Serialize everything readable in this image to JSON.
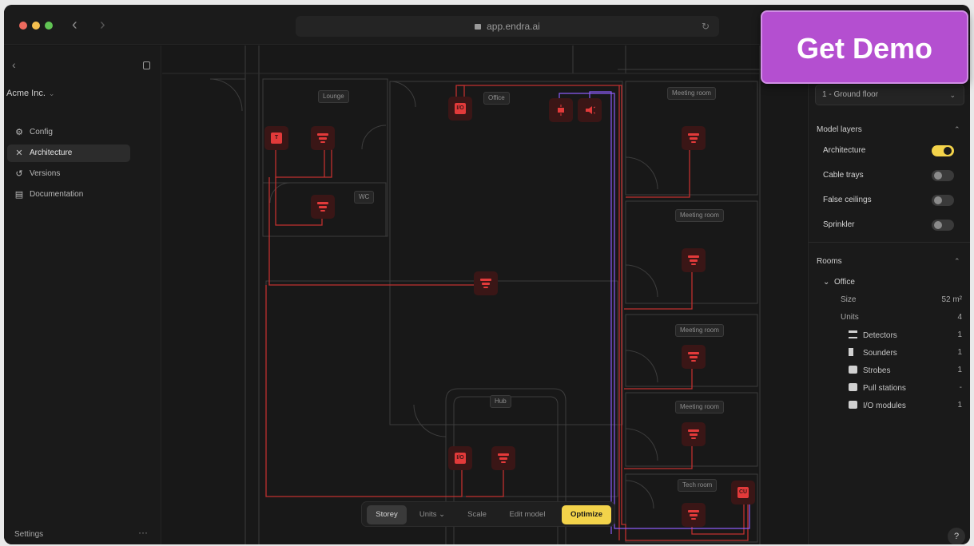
{
  "browser": {
    "url": "app.endra.ai"
  },
  "sidebar": {
    "org_name": "Acme Inc.",
    "items": [
      {
        "label": "Config",
        "icon": "config-icon"
      },
      {
        "label": "Architecture",
        "icon": "architecture-icon",
        "active": true
      },
      {
        "label": "Versions",
        "icon": "versions-icon"
      },
      {
        "label": "Documentation",
        "icon": "documentation-icon"
      }
    ],
    "settings_label": "Settings",
    "more_label": "···"
  },
  "canvas": {
    "rooms": [
      "Lounge",
      "Office",
      "Meeting room",
      "WC",
      "Meeting room",
      "Meeting room",
      "Hub",
      "Meeting room",
      "Tech room"
    ],
    "device_labels": {
      "io": "I/O",
      "pull": "T",
      "cu": "CU"
    }
  },
  "toolbar": {
    "storey": "Storey",
    "units": "Units",
    "scale": "Scale",
    "edit_model": "Edit model",
    "optimize": "Optimize"
  },
  "right_panel": {
    "floor": "1 - Ground floor",
    "model_layers_title": "Model layers",
    "layers": [
      {
        "label": "Architecture",
        "on": true
      },
      {
        "label": "Cable trays",
        "on": false
      },
      {
        "label": "False ceilings",
        "on": false
      },
      {
        "label": "Sprinkler",
        "on": false
      }
    ],
    "rooms_title": "Rooms",
    "room": {
      "name": "Office",
      "size_label": "Size",
      "size_value": "52 m²",
      "units_label": "Units",
      "units_value": "4",
      "units": [
        {
          "label": "Detectors",
          "value": "1",
          "icon": "detector-icon"
        },
        {
          "label": "Sounders",
          "value": "1",
          "icon": "sounder-icon"
        },
        {
          "label": "Strobes",
          "value": "1",
          "icon": "strobe-icon"
        },
        {
          "label": "Pull stations",
          "value": "-",
          "icon": "pull-station-icon"
        },
        {
          "label": "I/O modules",
          "value": "1",
          "icon": "io-module-icon"
        }
      ]
    },
    "help": "?"
  },
  "promo": {
    "label": "Get Demo"
  },
  "colors": {
    "accent": "#f3d34a",
    "device": "#e23a3a",
    "device_bg": "#3a1616",
    "cable": "#c0302f",
    "cable_alt": "#8b5cf6",
    "promo": "#b44fd0"
  }
}
